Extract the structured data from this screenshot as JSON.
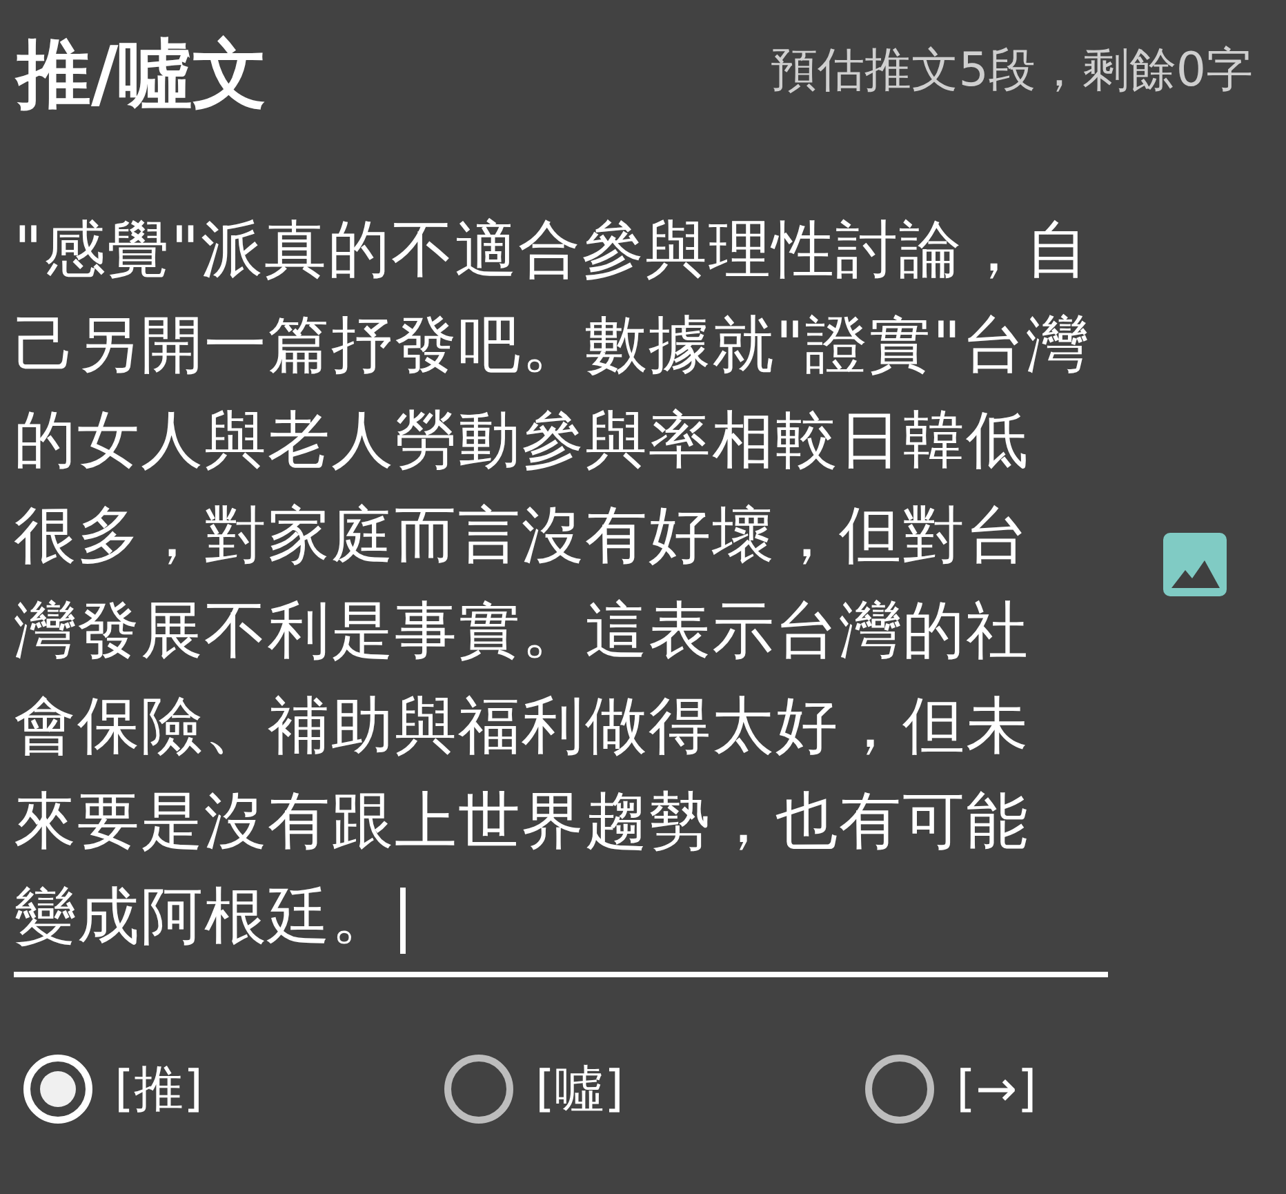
{
  "title": "推/噓文",
  "counter": "預估推文5段，剩餘0字",
  "editor": {
    "lines": [
      "\"感覺\"派真的不適合參與理性討論，自",
      "己另開一篇抒發吧。數據就\"證實\"台灣",
      "的女人與老人勞動參與率相較日韓低",
      "很多，對家庭而言沒有好壞，但對台",
      "灣發展不利是事實。這表示台灣的社",
      "會保險、補助與福利做得太好，但未",
      "來要是沒有跟上世界趨勢，也有可能",
      "變成阿根廷。"
    ],
    "focused": true
  },
  "options": [
    {
      "label": "[推]",
      "selected": true
    },
    {
      "label": "[噓]",
      "selected": false
    },
    {
      "label": "[→]",
      "selected": false
    }
  ]
}
